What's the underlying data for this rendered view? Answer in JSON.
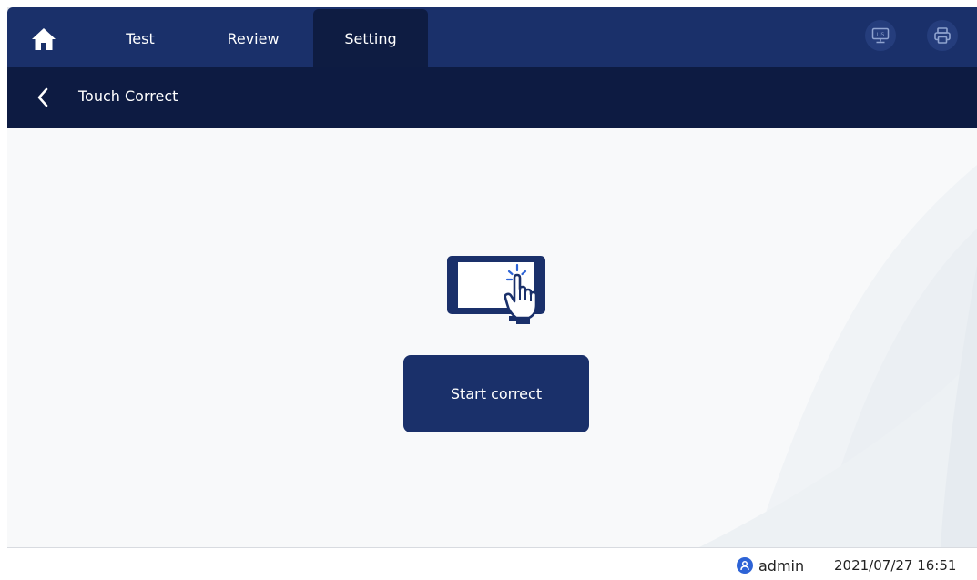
{
  "nav": {
    "tabs": [
      {
        "label": "Test",
        "active": false
      },
      {
        "label": "Review",
        "active": false
      },
      {
        "label": "Setting",
        "active": true
      }
    ],
    "icons": {
      "home": "home-icon",
      "lis": "lis-monitor-icon",
      "print": "printer-icon"
    },
    "lis_text": "LIS"
  },
  "subheader": {
    "title": "Touch Correct",
    "back_icon": "chevron-left-icon"
  },
  "main": {
    "illustration": "touch-screen-icon",
    "start_label": "Start correct"
  },
  "status": {
    "user": "admin",
    "datetime": "2021/07/27 16:51"
  },
  "colors": {
    "nav_bg": "#1a306a",
    "nav_active": "#0e1c42",
    "subheader_bg": "#0d1b42",
    "button_bg": "#1a306a",
    "content_bg": "#f8f9fa",
    "user_icon": "#2d63d6"
  }
}
